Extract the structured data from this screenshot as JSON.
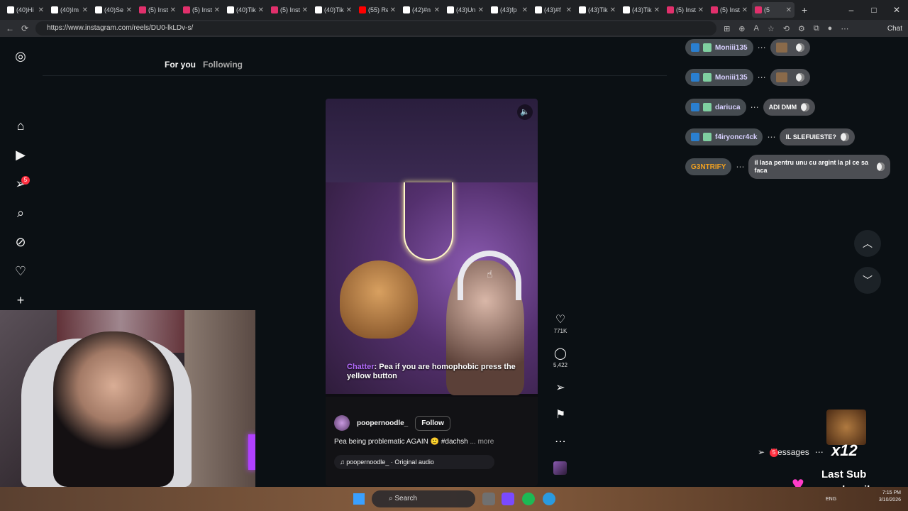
{
  "browser": {
    "tabs": [
      "(40)Hi",
      "(40)Im",
      "(40)Se",
      "(5) Inst",
      "(5) Inst",
      "(40)Tik",
      "(5) Inst",
      "(40)Tik",
      "(55) Re",
      "(42)#n",
      "(43)Un",
      "(43)fp",
      "(43)#f",
      "(43)Tik",
      "(43)Tik",
      "(5) Inst",
      "(5) Inst",
      "(5"
    ],
    "url": "https://www.instagram.com/reels/DU0-lkLDv-s/",
    "chat_label": "Chat",
    "new_tab": "+"
  },
  "feed": {
    "tab_for_you": "For you",
    "tab_following": "Following"
  },
  "sidebar": {
    "notification_count": "5"
  },
  "video": {
    "caption_speaker": "Chatter",
    "caption_text": ": Pea if you are homophobic press the yellow button",
    "username": "poopernoodle_",
    "follow_label": "Follow",
    "description": "Pea being problematic AGAIN 🙂 #dachsh",
    "more_label": "... more",
    "audio": "poopernoodle_ · Original audio"
  },
  "actions": {
    "likes": "771K",
    "comments": "5,422"
  },
  "overlay_chat": [
    {
      "name": "Moniii135",
      "message": ""
    },
    {
      "name": "Moniii135",
      "message": ""
    },
    {
      "name": "dariuca",
      "message": "ADI DMM"
    },
    {
      "name": "f4iryoncr4ck",
      "message": "IL SLEFUIESTE?"
    },
    {
      "name": "G3NTRIFY",
      "message": "il lasa pentru unu cu argint la pl ce sa faca"
    }
  ],
  "messages": {
    "label": "Messages",
    "count": "5"
  },
  "stream_overlay": {
    "multiplier": "x12",
    "last_sub_title": "Last Sub",
    "last_sub_name": "prodpxnik"
  },
  "taskbar": {
    "search_placeholder": "Search",
    "lang": "ENG",
    "time": "7:15 PM",
    "date": "3/10/2026"
  },
  "colors": {
    "accent_purple": "#b56cff",
    "notif_red": "#ff3040",
    "instagram_bg": "#0b1014"
  }
}
